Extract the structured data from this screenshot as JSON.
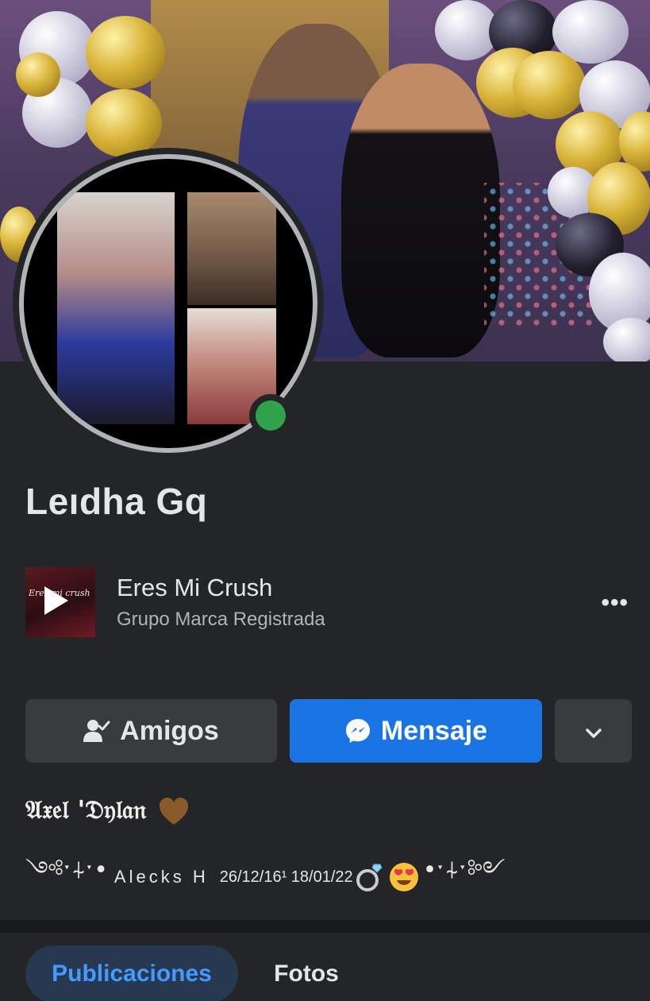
{
  "profile": {
    "name": "Leıdha Gq",
    "online": true
  },
  "music": {
    "title": "Eres Mi Crush",
    "artist": "Grupo Marca Registrada",
    "art_text": "Eres mi crush",
    "more_label": "•••"
  },
  "actions": {
    "friends_label": "Amigos",
    "message_label": "Mensaje",
    "more_icon": "chevron-down-icon"
  },
  "bio": {
    "line1": "𝔄𝔵𝔢𝔩 '𝔇𝔶𝔩𝔞𝔫",
    "line2_left_ornament": "༺ˑ⍭ˑ•",
    "line2_text": "Alecks H",
    "line2_dates": "26/12/16¹ 18/01/22",
    "line2_right_ornament": "•ˑ⍭ˑ༻"
  },
  "tabs": [
    {
      "label": "Publicaciones",
      "active": true
    },
    {
      "label": "Fotos",
      "active": false
    }
  ],
  "colors": {
    "background": "#242526",
    "primary_button": "#1b74e4",
    "secondary_button": "#3a3b3c",
    "online": "#31a24c",
    "active_tab_bg": "#263951",
    "active_tab_text": "#4599ff"
  }
}
